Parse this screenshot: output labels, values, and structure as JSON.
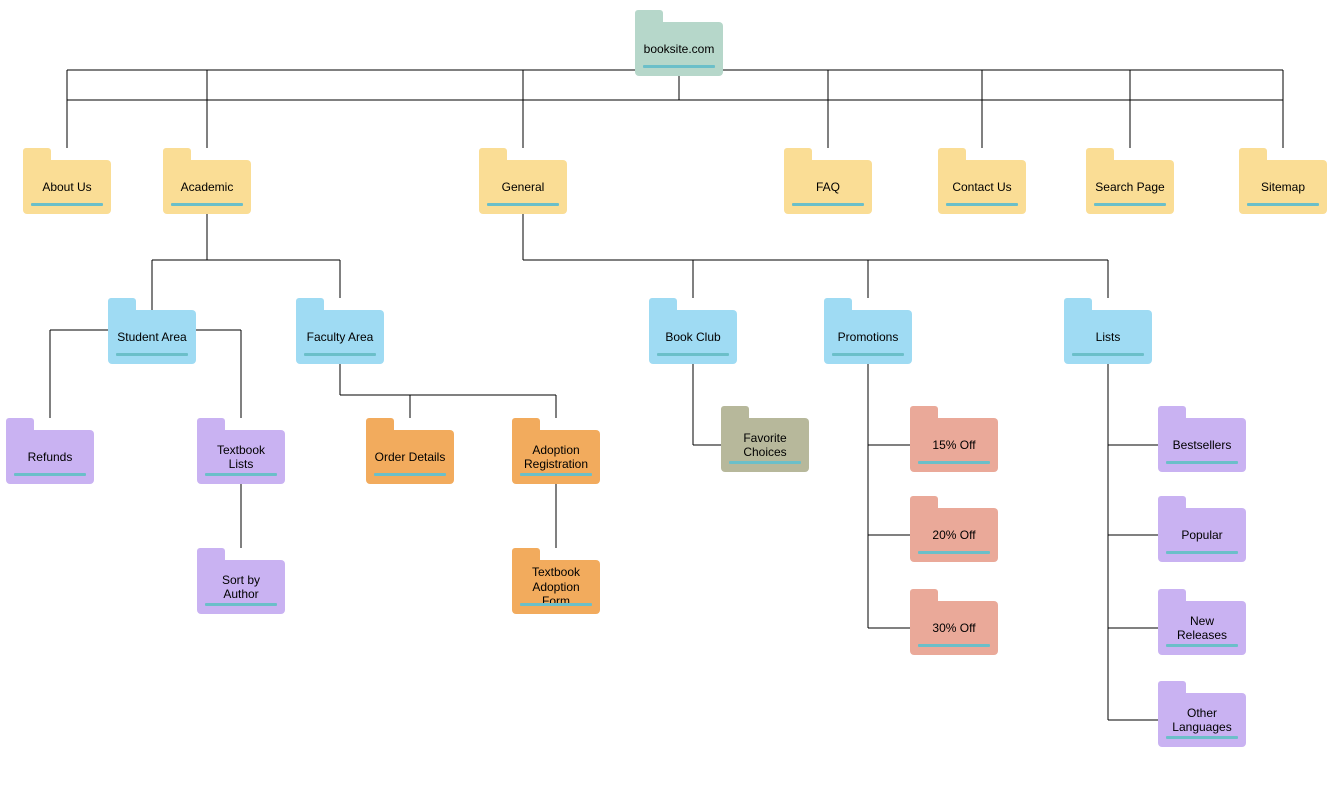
{
  "nodes": {
    "root": "booksite.com",
    "about": "About Us",
    "academic": "Academic",
    "general": "General",
    "faq": "FAQ",
    "contact": "Contact Us",
    "search": "Search Page",
    "sitemap": "Sitemap",
    "student": "Student Area",
    "faculty": "Faculty Area",
    "bookclub": "Book Club",
    "promotions": "Promotions",
    "lists": "Lists",
    "refunds": "Refunds",
    "textbooklists": "Textbook Lists",
    "sortauthor": "Sort by Author",
    "orderdetails": "Order Details",
    "adoptionreg": "Adoption Registration",
    "adoptionform": "Textbook Adoption Form",
    "favchoices": "Favorite Choices",
    "off15": "15% Off",
    "off20": "20% Off",
    "off30": "30% Off",
    "bestsellers": "Bestsellers",
    "popular": "Popular",
    "newreleases": "New Releases",
    "otherlang": "Other Languages"
  }
}
